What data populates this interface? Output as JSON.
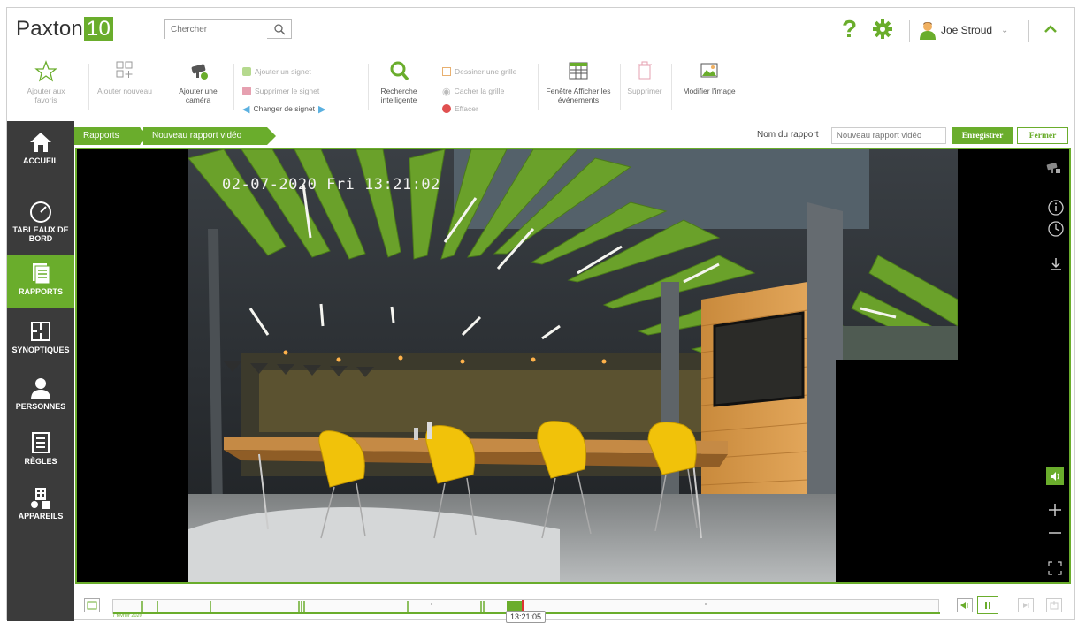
{
  "app": {
    "logo_text": "Paxton",
    "logo_badge": "10",
    "brand_color": "#6aad2c"
  },
  "search": {
    "placeholder": "Chercher"
  },
  "header": {
    "help_icon": "question-mark",
    "settings_icon": "gear-icon",
    "user_name": "Joe Stroud",
    "collapse_icon": "chevron-up-icon"
  },
  "ribbon": {
    "add_favorite": "Ajouter aux favoris",
    "add_new": "Ajouter nouveau",
    "add_camera": "Ajouter une caméra",
    "add_bookmark": "Ajouter un signet",
    "remove_bookmark": "Supprimer le signet",
    "change_bookmark": "Changer de signet",
    "smart_search": "Recherche intelligente",
    "draw_grid": "Dessiner une grille",
    "hide_grid": "Cacher la grille",
    "erase": "Effacer",
    "events_window": "Fenêtre Afficher les événements",
    "delete": "Supprimer",
    "edit_image": "Modifier l'image"
  },
  "leftnav": {
    "items": [
      {
        "label": "ACCUEIL",
        "icon": "home-icon",
        "active": false
      },
      {
        "label": "TABLEAUX DE BORD",
        "icon": "dashboard-gauge-icon",
        "active": false
      },
      {
        "label": "RAPPORTS",
        "icon": "reports-icon",
        "active": true
      },
      {
        "label": "SYNOPTIQUES",
        "icon": "floorplan-icon",
        "active": false
      },
      {
        "label": "PERSONNES",
        "icon": "person-icon",
        "active": false
      },
      {
        "label": "RÈGLES",
        "icon": "rules-list-icon",
        "active": false
      },
      {
        "label": "APPAREILS",
        "icon": "devices-icon",
        "active": false
      }
    ]
  },
  "breadcrumb": {
    "root": "Rapports",
    "current": "Nouveau rapport vidéo"
  },
  "report_form": {
    "name_label": "Nom du rapport",
    "name_placeholder": "Nouveau rapport vidéo",
    "save_label": "Enregistrer",
    "close_label": "Fermer"
  },
  "video": {
    "overlay_timestamp": "02-07-2020 Fri 13:21:02"
  },
  "timeline": {
    "start_date": "7 février 2020",
    "current_time": "13:21:05",
    "playhead_position": 0.495
  }
}
